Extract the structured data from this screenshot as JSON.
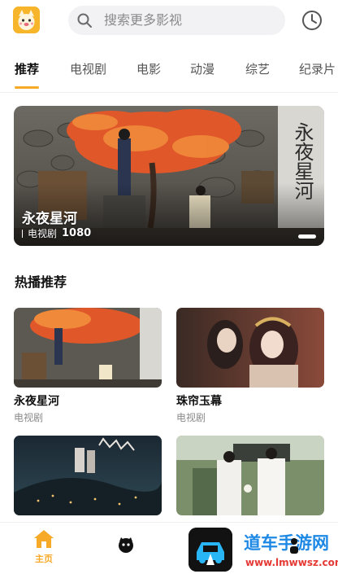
{
  "header": {
    "logo_icon": "app-logo-icon",
    "search_placeholder": "搜索更多影视",
    "history_icon": "clock-icon"
  },
  "tabs": [
    {
      "label": "推荐",
      "active": true
    },
    {
      "label": "电视剧"
    },
    {
      "label": "电影"
    },
    {
      "label": "动漫"
    },
    {
      "label": "综艺"
    },
    {
      "label": "纪录片"
    }
  ],
  "banner": {
    "title": "永夜星河",
    "category": "电视剧",
    "resolution": "1080",
    "calligraphy": "永夜星河"
  },
  "section": {
    "title": "热播推荐"
  },
  "cards": [
    {
      "title": "永夜星河",
      "sub": "电视剧"
    },
    {
      "title": "珠帘玉幕",
      "sub": "电视剧"
    },
    {
      "title": "",
      "sub": ""
    },
    {
      "title": "",
      "sub": ""
    }
  ],
  "bottom_nav": {
    "home_label": "主页",
    "watermark_text": "道车手游网",
    "watermark_url": "www.lmwwsz.com"
  },
  "colors": {
    "accent": "#f7a928",
    "watermark_blue": "#1e88e5"
  }
}
